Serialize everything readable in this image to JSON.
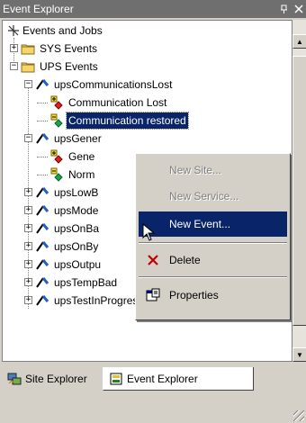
{
  "window": {
    "title": "Event Explorer",
    "pin_glyph": "⚀",
    "close_glyph": "✕"
  },
  "tree": {
    "root_label": "Events and Jobs",
    "nodes": [
      {
        "label": "SYS Events",
        "depth": 1,
        "toggle": "+",
        "icon": "folder-icon"
      },
      {
        "label": "UPS Events",
        "depth": 1,
        "toggle": "−",
        "icon": "folder-icon"
      },
      {
        "label": "upsCommunicationsLost",
        "depth": 2,
        "toggle": "−",
        "icon": "event-icon"
      },
      {
        "label": "Communication Lost",
        "depth": 3,
        "toggle": "",
        "icon": "alarm-icon"
      },
      {
        "label": "Communication restored",
        "depth": 3,
        "toggle": "",
        "icon": "restore-icon",
        "selected": true
      },
      {
        "label": "upsGener",
        "depth": 2,
        "toggle": "−",
        "icon": "event-icon"
      },
      {
        "label": "Gene",
        "depth": 3,
        "toggle": "",
        "icon": "alarm-icon"
      },
      {
        "label": "Norm",
        "depth": 3,
        "toggle": "",
        "icon": "restore-icon"
      },
      {
        "label": "upsLowB",
        "depth": 2,
        "toggle": "+",
        "icon": "event-icon"
      },
      {
        "label": "upsMode",
        "depth": 2,
        "toggle": "+",
        "icon": "event-icon"
      },
      {
        "label": "upsOnBa",
        "depth": 2,
        "toggle": "+",
        "icon": "event-icon"
      },
      {
        "label": "upsOnBy",
        "depth": 2,
        "toggle": "+",
        "icon": "event-icon"
      },
      {
        "label": "upsOutpu",
        "depth": 2,
        "toggle": "+",
        "icon": "event-icon"
      },
      {
        "label": "upsTempBad",
        "depth": 2,
        "toggle": "+",
        "icon": "event-icon"
      },
      {
        "label": "upsTestInProgress",
        "depth": 2,
        "toggle": "+",
        "icon": "event-icon"
      }
    ]
  },
  "context_menu": {
    "new_site": "New Site...",
    "new_service": "New Service...",
    "new_event": "New Event...",
    "delete": "Delete",
    "properties": "Properties"
  },
  "tabs": {
    "site_explorer": "Site Explorer",
    "event_explorer": "Event Explorer"
  },
  "colors": {
    "selection": "#0a246a",
    "folder": "#f6d56b",
    "titlebar": "#6f6f6f"
  }
}
